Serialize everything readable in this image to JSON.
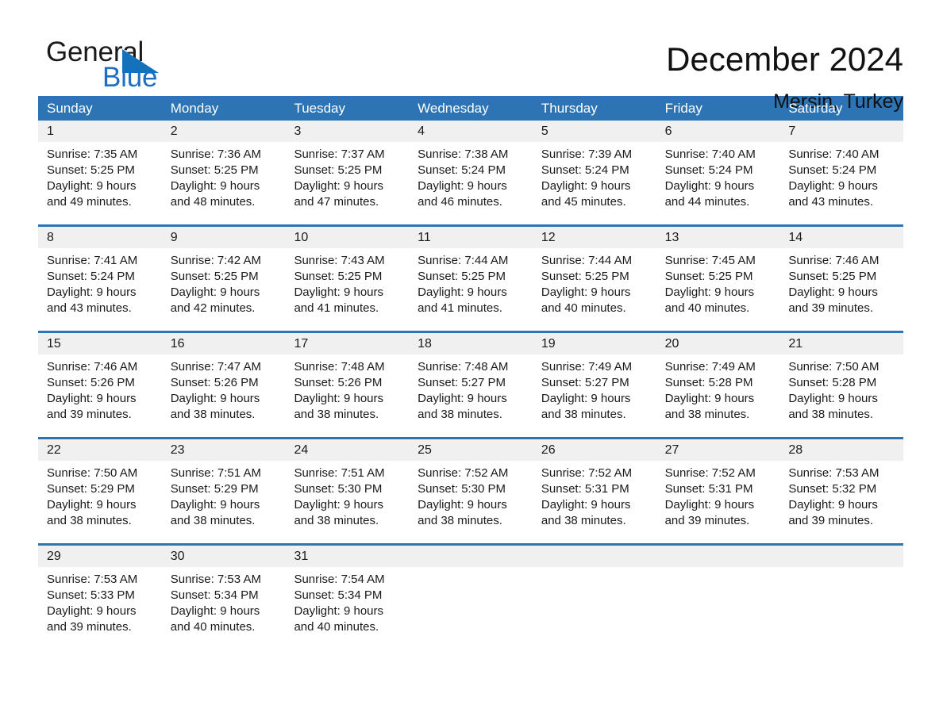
{
  "brand": {
    "name_part1": "General",
    "name_part2": "Blue",
    "accent_color": "#1372bb"
  },
  "header": {
    "month_title": "December 2024",
    "location": "Mersin, Turkey",
    "header_bg_color": "#2d74b5",
    "daynum_bg_color": "#f0f0f0"
  },
  "weekdays": [
    "Sunday",
    "Monday",
    "Tuesday",
    "Wednesday",
    "Thursday",
    "Friday",
    "Saturday"
  ],
  "weeks": [
    [
      {
        "day": "1",
        "sunrise": "Sunrise: 7:35 AM",
        "sunset": "Sunset: 5:25 PM",
        "daylight1": "Daylight: 9 hours",
        "daylight2": "and 49 minutes."
      },
      {
        "day": "2",
        "sunrise": "Sunrise: 7:36 AM",
        "sunset": "Sunset: 5:25 PM",
        "daylight1": "Daylight: 9 hours",
        "daylight2": "and 48 minutes."
      },
      {
        "day": "3",
        "sunrise": "Sunrise: 7:37 AM",
        "sunset": "Sunset: 5:25 PM",
        "daylight1": "Daylight: 9 hours",
        "daylight2": "and 47 minutes."
      },
      {
        "day": "4",
        "sunrise": "Sunrise: 7:38 AM",
        "sunset": "Sunset: 5:24 PM",
        "daylight1": "Daylight: 9 hours",
        "daylight2": "and 46 minutes."
      },
      {
        "day": "5",
        "sunrise": "Sunrise: 7:39 AM",
        "sunset": "Sunset: 5:24 PM",
        "daylight1": "Daylight: 9 hours",
        "daylight2": "and 45 minutes."
      },
      {
        "day": "6",
        "sunrise": "Sunrise: 7:40 AM",
        "sunset": "Sunset: 5:24 PM",
        "daylight1": "Daylight: 9 hours",
        "daylight2": "and 44 minutes."
      },
      {
        "day": "7",
        "sunrise": "Sunrise: 7:40 AM",
        "sunset": "Sunset: 5:24 PM",
        "daylight1": "Daylight: 9 hours",
        "daylight2": "and 43 minutes."
      }
    ],
    [
      {
        "day": "8",
        "sunrise": "Sunrise: 7:41 AM",
        "sunset": "Sunset: 5:24 PM",
        "daylight1": "Daylight: 9 hours",
        "daylight2": "and 43 minutes."
      },
      {
        "day": "9",
        "sunrise": "Sunrise: 7:42 AM",
        "sunset": "Sunset: 5:25 PM",
        "daylight1": "Daylight: 9 hours",
        "daylight2": "and 42 minutes."
      },
      {
        "day": "10",
        "sunrise": "Sunrise: 7:43 AM",
        "sunset": "Sunset: 5:25 PM",
        "daylight1": "Daylight: 9 hours",
        "daylight2": "and 41 minutes."
      },
      {
        "day": "11",
        "sunrise": "Sunrise: 7:44 AM",
        "sunset": "Sunset: 5:25 PM",
        "daylight1": "Daylight: 9 hours",
        "daylight2": "and 41 minutes."
      },
      {
        "day": "12",
        "sunrise": "Sunrise: 7:44 AM",
        "sunset": "Sunset: 5:25 PM",
        "daylight1": "Daylight: 9 hours",
        "daylight2": "and 40 minutes."
      },
      {
        "day": "13",
        "sunrise": "Sunrise: 7:45 AM",
        "sunset": "Sunset: 5:25 PM",
        "daylight1": "Daylight: 9 hours",
        "daylight2": "and 40 minutes."
      },
      {
        "day": "14",
        "sunrise": "Sunrise: 7:46 AM",
        "sunset": "Sunset: 5:25 PM",
        "daylight1": "Daylight: 9 hours",
        "daylight2": "and 39 minutes."
      }
    ],
    [
      {
        "day": "15",
        "sunrise": "Sunrise: 7:46 AM",
        "sunset": "Sunset: 5:26 PM",
        "daylight1": "Daylight: 9 hours",
        "daylight2": "and 39 minutes."
      },
      {
        "day": "16",
        "sunrise": "Sunrise: 7:47 AM",
        "sunset": "Sunset: 5:26 PM",
        "daylight1": "Daylight: 9 hours",
        "daylight2": "and 38 minutes."
      },
      {
        "day": "17",
        "sunrise": "Sunrise: 7:48 AM",
        "sunset": "Sunset: 5:26 PM",
        "daylight1": "Daylight: 9 hours",
        "daylight2": "and 38 minutes."
      },
      {
        "day": "18",
        "sunrise": "Sunrise: 7:48 AM",
        "sunset": "Sunset: 5:27 PM",
        "daylight1": "Daylight: 9 hours",
        "daylight2": "and 38 minutes."
      },
      {
        "day": "19",
        "sunrise": "Sunrise: 7:49 AM",
        "sunset": "Sunset: 5:27 PM",
        "daylight1": "Daylight: 9 hours",
        "daylight2": "and 38 minutes."
      },
      {
        "day": "20",
        "sunrise": "Sunrise: 7:49 AM",
        "sunset": "Sunset: 5:28 PM",
        "daylight1": "Daylight: 9 hours",
        "daylight2": "and 38 minutes."
      },
      {
        "day": "21",
        "sunrise": "Sunrise: 7:50 AM",
        "sunset": "Sunset: 5:28 PM",
        "daylight1": "Daylight: 9 hours",
        "daylight2": "and 38 minutes."
      }
    ],
    [
      {
        "day": "22",
        "sunrise": "Sunrise: 7:50 AM",
        "sunset": "Sunset: 5:29 PM",
        "daylight1": "Daylight: 9 hours",
        "daylight2": "and 38 minutes."
      },
      {
        "day": "23",
        "sunrise": "Sunrise: 7:51 AM",
        "sunset": "Sunset: 5:29 PM",
        "daylight1": "Daylight: 9 hours",
        "daylight2": "and 38 minutes."
      },
      {
        "day": "24",
        "sunrise": "Sunrise: 7:51 AM",
        "sunset": "Sunset: 5:30 PM",
        "daylight1": "Daylight: 9 hours",
        "daylight2": "and 38 minutes."
      },
      {
        "day": "25",
        "sunrise": "Sunrise: 7:52 AM",
        "sunset": "Sunset: 5:30 PM",
        "daylight1": "Daylight: 9 hours",
        "daylight2": "and 38 minutes."
      },
      {
        "day": "26",
        "sunrise": "Sunrise: 7:52 AM",
        "sunset": "Sunset: 5:31 PM",
        "daylight1": "Daylight: 9 hours",
        "daylight2": "and 38 minutes."
      },
      {
        "day": "27",
        "sunrise": "Sunrise: 7:52 AM",
        "sunset": "Sunset: 5:31 PM",
        "daylight1": "Daylight: 9 hours",
        "daylight2": "and 39 minutes."
      },
      {
        "day": "28",
        "sunrise": "Sunrise: 7:53 AM",
        "sunset": "Sunset: 5:32 PM",
        "daylight1": "Daylight: 9 hours",
        "daylight2": "and 39 minutes."
      }
    ],
    [
      {
        "day": "29",
        "sunrise": "Sunrise: 7:53 AM",
        "sunset": "Sunset: 5:33 PM",
        "daylight1": "Daylight: 9 hours",
        "daylight2": "and 39 minutes."
      },
      {
        "day": "30",
        "sunrise": "Sunrise: 7:53 AM",
        "sunset": "Sunset: 5:34 PM",
        "daylight1": "Daylight: 9 hours",
        "daylight2": "and 40 minutes."
      },
      {
        "day": "31",
        "sunrise": "Sunrise: 7:54 AM",
        "sunset": "Sunset: 5:34 PM",
        "daylight1": "Daylight: 9 hours",
        "daylight2": "and 40 minutes."
      },
      {
        "day": "",
        "sunrise": "",
        "sunset": "",
        "daylight1": "",
        "daylight2": ""
      },
      {
        "day": "",
        "sunrise": "",
        "sunset": "",
        "daylight1": "",
        "daylight2": ""
      },
      {
        "day": "",
        "sunrise": "",
        "sunset": "",
        "daylight1": "",
        "daylight2": ""
      },
      {
        "day": "",
        "sunrise": "",
        "sunset": "",
        "daylight1": "",
        "daylight2": ""
      }
    ]
  ]
}
